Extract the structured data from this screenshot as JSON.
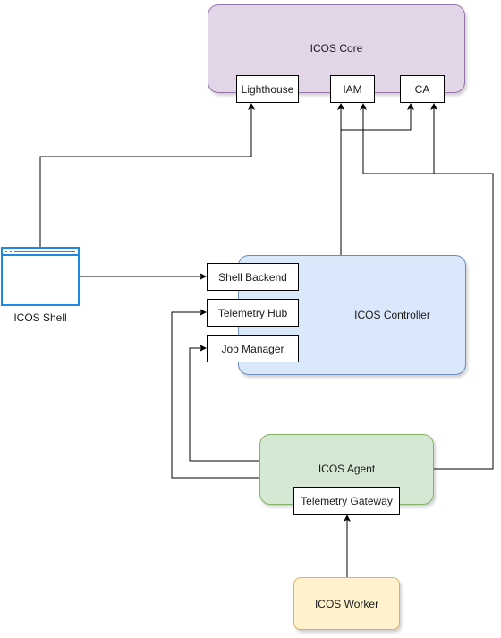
{
  "diagram": {
    "groups": {
      "core": {
        "label": "ICOS Core",
        "fill": "#e1d5e7",
        "stroke": "#9673a6"
      },
      "controller": {
        "label": "ICOS Controller",
        "fill": "#dae8fc",
        "stroke": "#6c8ebf"
      },
      "agent": {
        "label": "ICOS Agent",
        "fill": "#d5e8d4",
        "stroke": "#82b366"
      },
      "worker": {
        "label": "ICOS Worker",
        "fill": "#fff2cc",
        "stroke": "#d6b656"
      }
    },
    "components": {
      "lighthouse": "Lighthouse",
      "iam": "IAM",
      "ca": "CA",
      "shell_backend": "Shell Backend",
      "telemetry_hub": "Telemetry Hub",
      "job_manager": "Job Manager",
      "telemetry_gateway": "Telemetry Gateway"
    },
    "shell": {
      "label": "ICOS Shell",
      "icon": "browser-window-icon",
      "color": "#1e88e5"
    },
    "edges": [
      {
        "from": "ICOS Shell",
        "to": "Lighthouse"
      },
      {
        "from": "ICOS Shell",
        "to": "Shell Backend"
      },
      {
        "from": "ICOS Controller",
        "to": "IAM"
      },
      {
        "from": "ICOS Controller",
        "to": "CA"
      },
      {
        "from": "ICOS Agent",
        "to": "IAM"
      },
      {
        "from": "ICOS Agent",
        "to": "CA"
      },
      {
        "from": "ICOS Agent",
        "to": "Telemetry Hub"
      },
      {
        "from": "ICOS Agent",
        "to": "Job Manager"
      },
      {
        "from": "ICOS Worker",
        "to": "Telemetry Gateway"
      }
    ]
  }
}
